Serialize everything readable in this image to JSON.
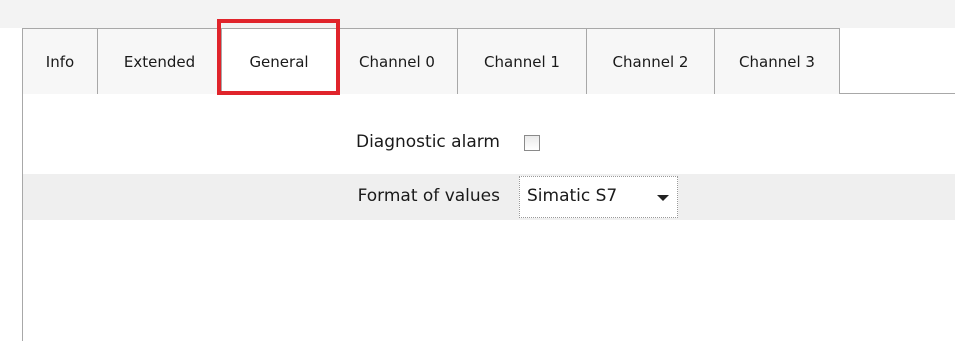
{
  "tabs": [
    {
      "label": "Info"
    },
    {
      "label": "Extended"
    },
    {
      "label": "General",
      "active": true
    },
    {
      "label": "Channel 0"
    },
    {
      "label": "Channel 1"
    },
    {
      "label": "Channel 2"
    },
    {
      "label": "Channel 3"
    }
  ],
  "general": {
    "diagnostic_alarm": {
      "label": "Diagnostic alarm",
      "checked": false
    },
    "format_of_values": {
      "label": "Format of values",
      "value": "Simatic S7"
    }
  },
  "colors": {
    "highlight": "#e0242b",
    "shaded_row": "#efefef"
  }
}
